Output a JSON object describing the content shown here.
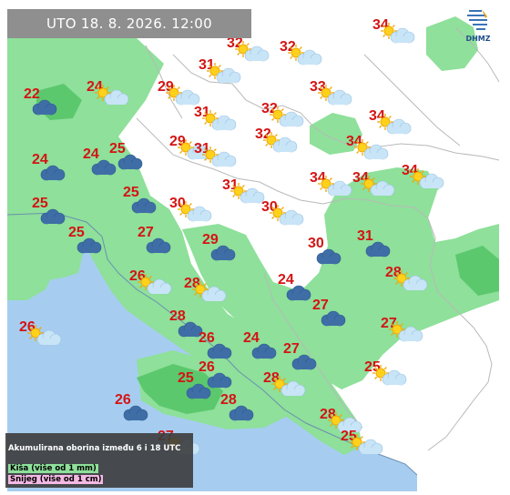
{
  "header": {
    "datetime": "UTO  18. 8. 2026. 12:00"
  },
  "logo": {
    "text": "DHMZ"
  },
  "legend": {
    "title": "Akumulirana oborina između 6 i 18 UTC",
    "rain": "Kiša (više od 1 mm)",
    "snow": "Snijeg (više od 1 cm)"
  },
  "colors": {
    "rain": "#8ee09a",
    "snow": "#f4b8e4",
    "sea": "#a6cdf0",
    "land": "#ffffff",
    "temperature": "#d41414"
  },
  "stations": [
    {
      "temp": "32",
      "icon": "sun-cloud-icon",
      "lon": 17.0,
      "lat": 47.15
    },
    {
      "temp": "32",
      "icon": "sun-cloud-icon",
      "lon": 18.3,
      "lat": 47.1
    },
    {
      "temp": "34",
      "icon": "sun-cloud-icon",
      "lon": 20.6,
      "lat": 47.4
    },
    {
      "temp": "31",
      "icon": "sun-cloud-icon",
      "lon": 16.3,
      "lat": 46.85
    },
    {
      "temp": "33",
      "icon": "sun-cloud-icon",
      "lon": 19.05,
      "lat": 46.55
    },
    {
      "temp": "24",
      "icon": "sun-cloud-icon",
      "lon": 13.55,
      "lat": 46.55
    },
    {
      "temp": "29",
      "icon": "sun-cloud-icon",
      "lon": 15.3,
      "lat": 46.55
    },
    {
      "temp": "22",
      "icon": "cloud-icon",
      "lon": 12.0,
      "lat": 46.45
    },
    {
      "temp": "31",
      "icon": "sun-cloud-icon",
      "lon": 16.2,
      "lat": 46.2
    },
    {
      "temp": "32",
      "icon": "sun-cloud-icon",
      "lon": 17.85,
      "lat": 46.25
    },
    {
      "temp": "34",
      "icon": "sun-cloud-icon",
      "lon": 20.5,
      "lat": 46.15
    },
    {
      "temp": "29",
      "icon": "sun-cloud-icon",
      "lon": 15.6,
      "lat": 45.8
    },
    {
      "temp": "31",
      "icon": "sun-cloud-icon",
      "lon": 16.2,
      "lat": 45.7
    },
    {
      "temp": "32",
      "icon": "sun-cloud-icon",
      "lon": 17.7,
      "lat": 45.9
    },
    {
      "temp": "34",
      "icon": "sun-cloud-icon",
      "lon": 19.95,
      "lat": 45.8
    },
    {
      "temp": "24",
      "icon": "cloud-icon",
      "lon": 12.2,
      "lat": 45.55
    },
    {
      "temp": "24",
      "icon": "cloud-icon",
      "lon": 13.45,
      "lat": 45.62
    },
    {
      "temp": "25",
      "icon": "cloud-icon",
      "lon": 14.1,
      "lat": 45.7
    },
    {
      "temp": "34",
      "icon": "sun-cloud-icon",
      "lon": 19.05,
      "lat": 45.3
    },
    {
      "temp": "34",
      "icon": "sun-cloud-icon",
      "lon": 20.1,
      "lat": 45.3
    },
    {
      "temp": "34",
      "icon": "sun-cloud-icon",
      "lon": 21.3,
      "lat": 45.4
    },
    {
      "temp": "31",
      "icon": "sun-cloud-icon",
      "lon": 16.9,
      "lat": 45.2
    },
    {
      "temp": "25",
      "icon": "cloud-icon",
      "lon": 12.2,
      "lat": 44.95
    },
    {
      "temp": "25",
      "icon": "cloud-icon",
      "lon": 14.45,
      "lat": 45.1
    },
    {
      "temp": "30",
      "icon": "sun-cloud-icon",
      "lon": 15.6,
      "lat": 44.95
    },
    {
      "temp": "30",
      "icon": "sun-cloud-icon",
      "lon": 17.85,
      "lat": 44.9
    },
    {
      "temp": "25",
      "icon": "cloud-icon",
      "lon": 13.1,
      "lat": 44.55
    },
    {
      "temp": "27",
      "icon": "cloud-icon",
      "lon": 14.8,
      "lat": 44.55
    },
    {
      "temp": "29",
      "icon": "cloud-icon",
      "lon": 16.4,
      "lat": 44.45
    },
    {
      "temp": "30",
      "icon": "cloud-icon",
      "lon": 19.0,
      "lat": 44.4
    },
    {
      "temp": "31",
      "icon": "cloud-icon",
      "lon": 20.2,
      "lat": 44.5
    },
    {
      "temp": "26",
      "icon": "sun-cloud-icon",
      "lon": 14.6,
      "lat": 43.95
    },
    {
      "temp": "28",
      "icon": "sun-cloud-icon",
      "lon": 15.95,
      "lat": 43.85
    },
    {
      "temp": "24",
      "icon": "cloud-icon",
      "lon": 18.25,
      "lat": 43.9
    },
    {
      "temp": "28",
      "icon": "sun-cloud-icon",
      "lon": 20.9,
      "lat": 44.0
    },
    {
      "temp": "27",
      "icon": "cloud-icon",
      "lon": 19.1,
      "lat": 43.55
    },
    {
      "temp": "28",
      "icon": "cloud-icon",
      "lon": 15.6,
      "lat": 43.4
    },
    {
      "temp": "26",
      "icon": "sun-cloud-icon",
      "lon": 11.9,
      "lat": 43.25
    },
    {
      "temp": "26",
      "icon": "cloud-icon",
      "lon": 16.3,
      "lat": 43.1
    },
    {
      "temp": "24",
      "icon": "cloud-icon",
      "lon": 17.4,
      "lat": 43.1
    },
    {
      "temp": "27",
      "icon": "sun-cloud-icon",
      "lon": 20.8,
      "lat": 43.3
    },
    {
      "temp": "27",
      "icon": "cloud-icon",
      "lon": 18.4,
      "lat": 42.95
    },
    {
      "temp": "26",
      "icon": "cloud-icon",
      "lon": 16.3,
      "lat": 42.7
    },
    {
      "temp": "25",
      "icon": "cloud-icon",
      "lon": 15.8,
      "lat": 42.55
    },
    {
      "temp": "28",
      "icon": "sun-cloud-icon",
      "lon": 17.9,
      "lat": 42.55
    },
    {
      "temp": "25",
      "icon": "sun-cloud-icon",
      "lon": 20.4,
      "lat": 42.7
    },
    {
      "temp": "28",
      "icon": "cloud-icon",
      "lon": 16.85,
      "lat": 42.25
    },
    {
      "temp": "26",
      "icon": "cloud-icon",
      "lon": 14.25,
      "lat": 42.25
    },
    {
      "temp": "28",
      "icon": "sun-cloud-icon",
      "lon": 19.3,
      "lat": 42.05
    },
    {
      "temp": "27",
      "icon": "sun-cloud-icon",
      "lon": 15.3,
      "lat": 41.75
    },
    {
      "temp": "25",
      "icon": "sun-cloud-icon",
      "lon": 19.8,
      "lat": 41.75
    }
  ]
}
